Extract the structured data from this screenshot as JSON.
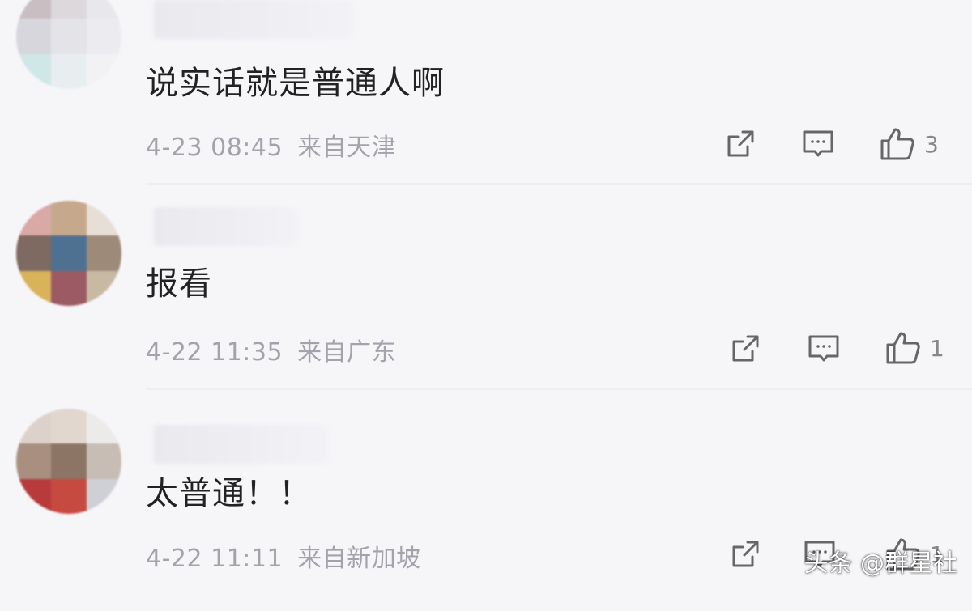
{
  "comments": [
    {
      "text": "说实话就是普通人啊",
      "time": "4-23 08:45",
      "location": "来自天津",
      "likes": "3",
      "avatar_colors": [
        "#c9bfc2",
        "#dcd8dc",
        "#e8e8ec",
        "#d6d6dc",
        "#e4e4e8",
        "#ececf0",
        "#cfe7e6",
        "#e8eef0",
        "#f2f2f5"
      ]
    },
    {
      "text": "报看",
      "time": "4-22 11:35",
      "location": "来自广东",
      "likes": "1",
      "avatar_colors": [
        "#d9a9a6",
        "#c6a98d",
        "#e7dfd6",
        "#7e6a60",
        "#4f7191",
        "#9d8a79",
        "#d9b35a",
        "#9c5a64",
        "#c8b9a3"
      ]
    },
    {
      "text": "太普通！！",
      "time": "4-22 11:11",
      "location": "来自新加坡",
      "likes": "1",
      "avatar_colors": [
        "#dcd2cb",
        "#e2d7ce",
        "#ecebea",
        "#a98f7f",
        "#8c7564",
        "#c7bdb4",
        "#b83a3a",
        "#c64a40",
        "#cfcfd6"
      ]
    }
  ],
  "watermark": "头条 @群星社"
}
